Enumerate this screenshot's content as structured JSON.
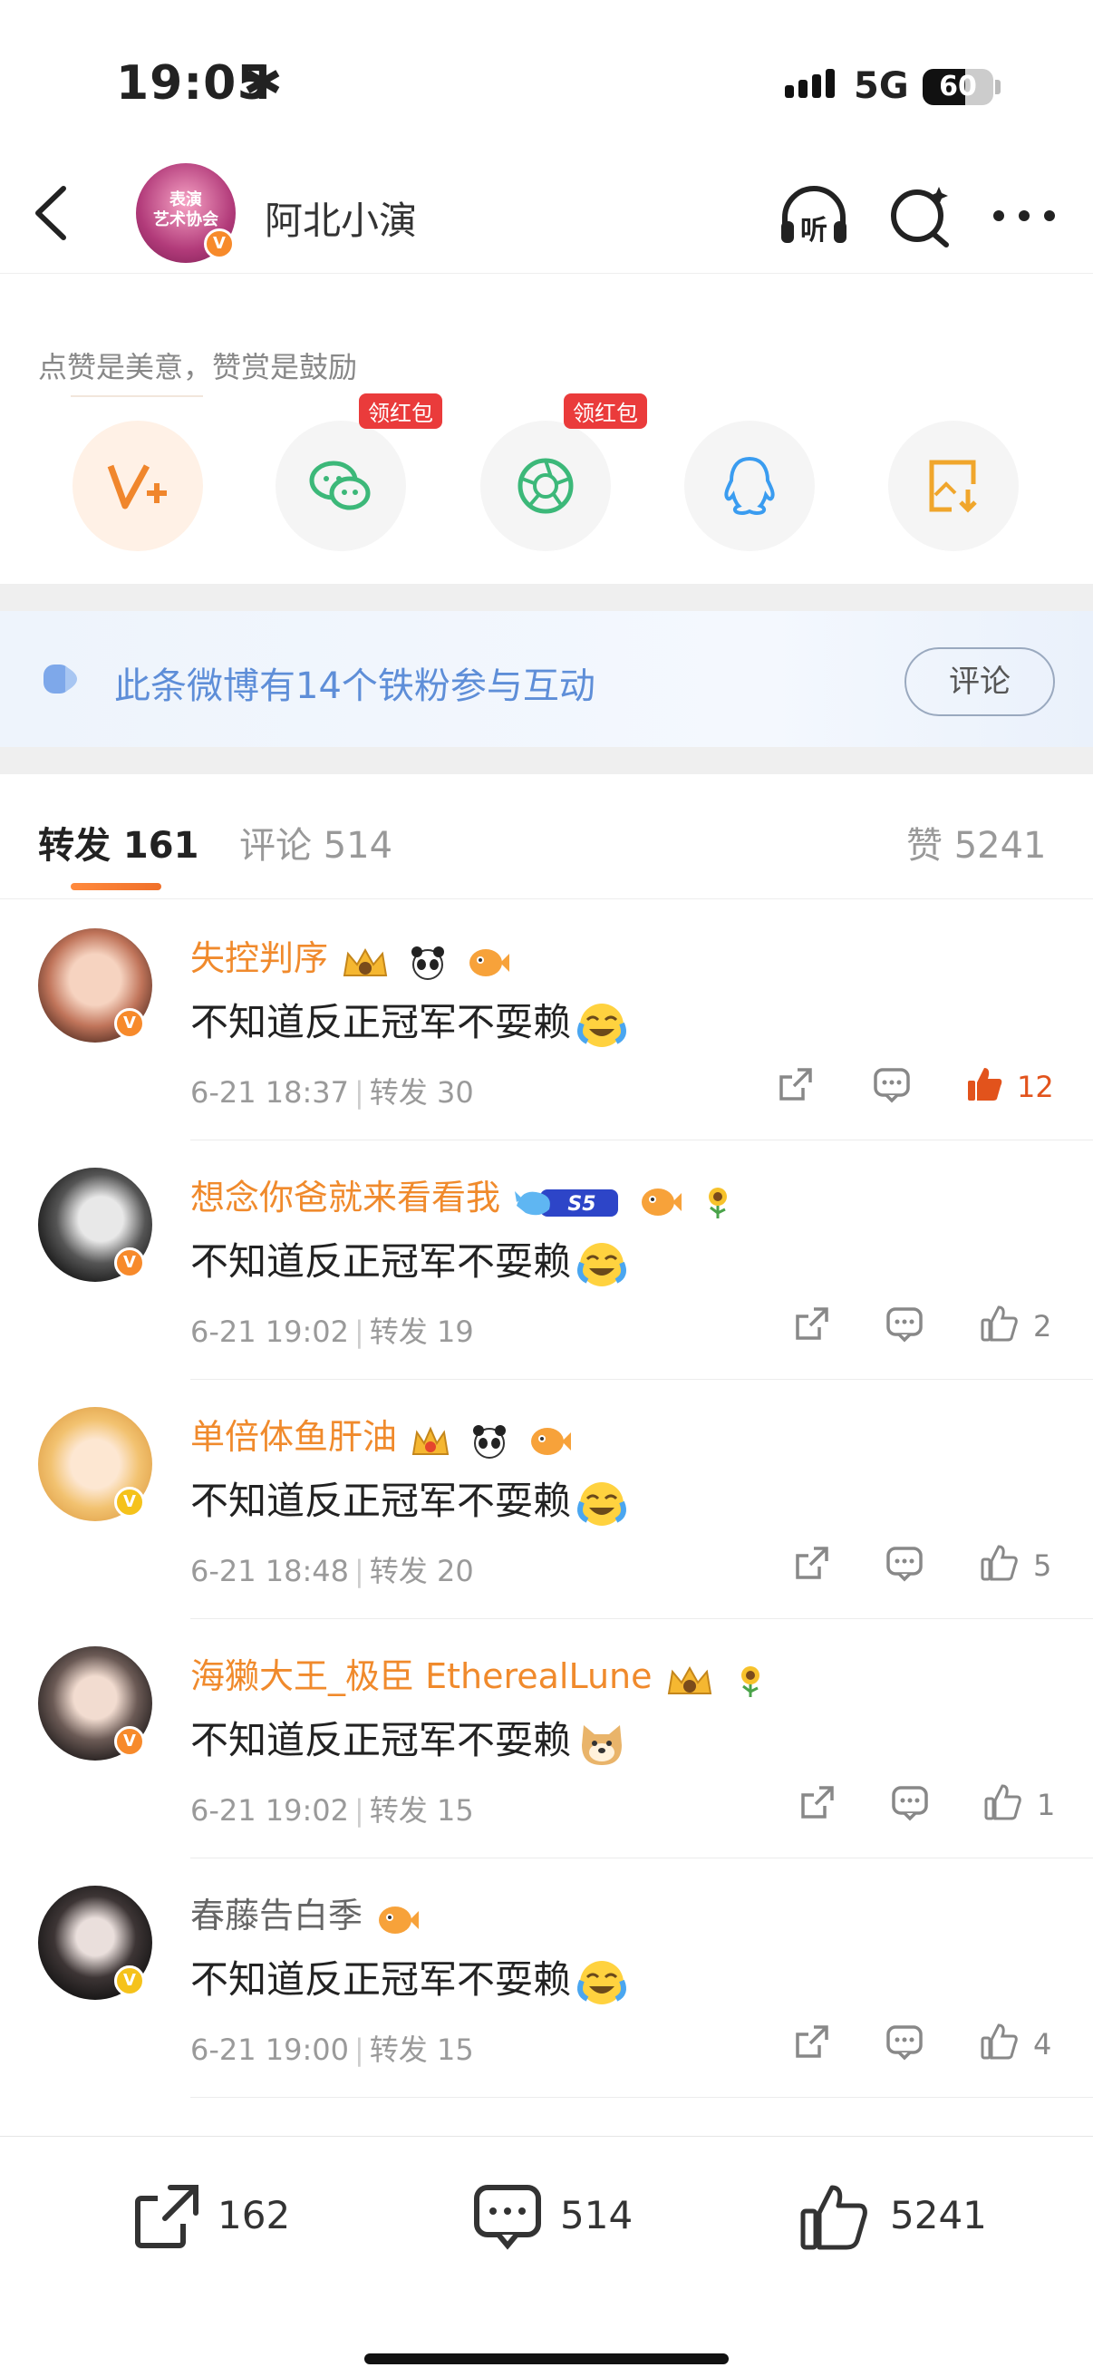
{
  "status": {
    "time": "19:05",
    "network": "5G",
    "battery": "60",
    "battery_level": 0.6
  },
  "header": {
    "title": "阿北小演",
    "avatar_text_1": "表演",
    "avatar_text_2": "艺术协会"
  },
  "tip": "点赞是美意，赞赏是鼓励",
  "share": {
    "tag1": "领红包",
    "tag2": "领红包"
  },
  "fan_banner": {
    "text": "此条微博有14个铁粉参与互动",
    "button": "评论"
  },
  "tabs": {
    "repost": "转发 161",
    "comment": "评论 514",
    "like": "赞 5241"
  },
  "repost_label": "转发",
  "colors": {
    "accent": "#f08a2c",
    "like_hot": "#e2531c",
    "fan_blue": "#5e8ed8"
  },
  "reposts": [
    {
      "name": "失控判序",
      "text": "不知道反正冠军不耍赖",
      "date": "6-21 18:37",
      "repost": "30",
      "likes": "12",
      "emoji": "crying-laughing"
    },
    {
      "name": "想念你爸就来看看我",
      "text": "不知道反正冠军不耍赖",
      "date": "6-21 19:02",
      "repost": "19",
      "likes": "2",
      "emoji": "crying-laughing",
      "level_badge": "S5"
    },
    {
      "name": "单倍体鱼肝油",
      "text": "不知道反正冠军不耍赖",
      "date": "6-21 18:48",
      "repost": "20",
      "likes": "5",
      "emoji": "crying-laughing"
    },
    {
      "name": "海獭大王_极臣 EtherealLune",
      "text": "不知道反正冠军不耍赖",
      "date": "6-21 19:02",
      "repost": "15",
      "likes": "1",
      "emoji": "doge"
    },
    {
      "name": "春藤告白季",
      "text": "不知道反正冠军不耍赖",
      "date": "6-21 19:00",
      "repost": "15",
      "likes": "4",
      "emoji": "crying-laughing"
    }
  ],
  "bottom": {
    "repost": "162",
    "comment": "514",
    "like": "5241"
  }
}
